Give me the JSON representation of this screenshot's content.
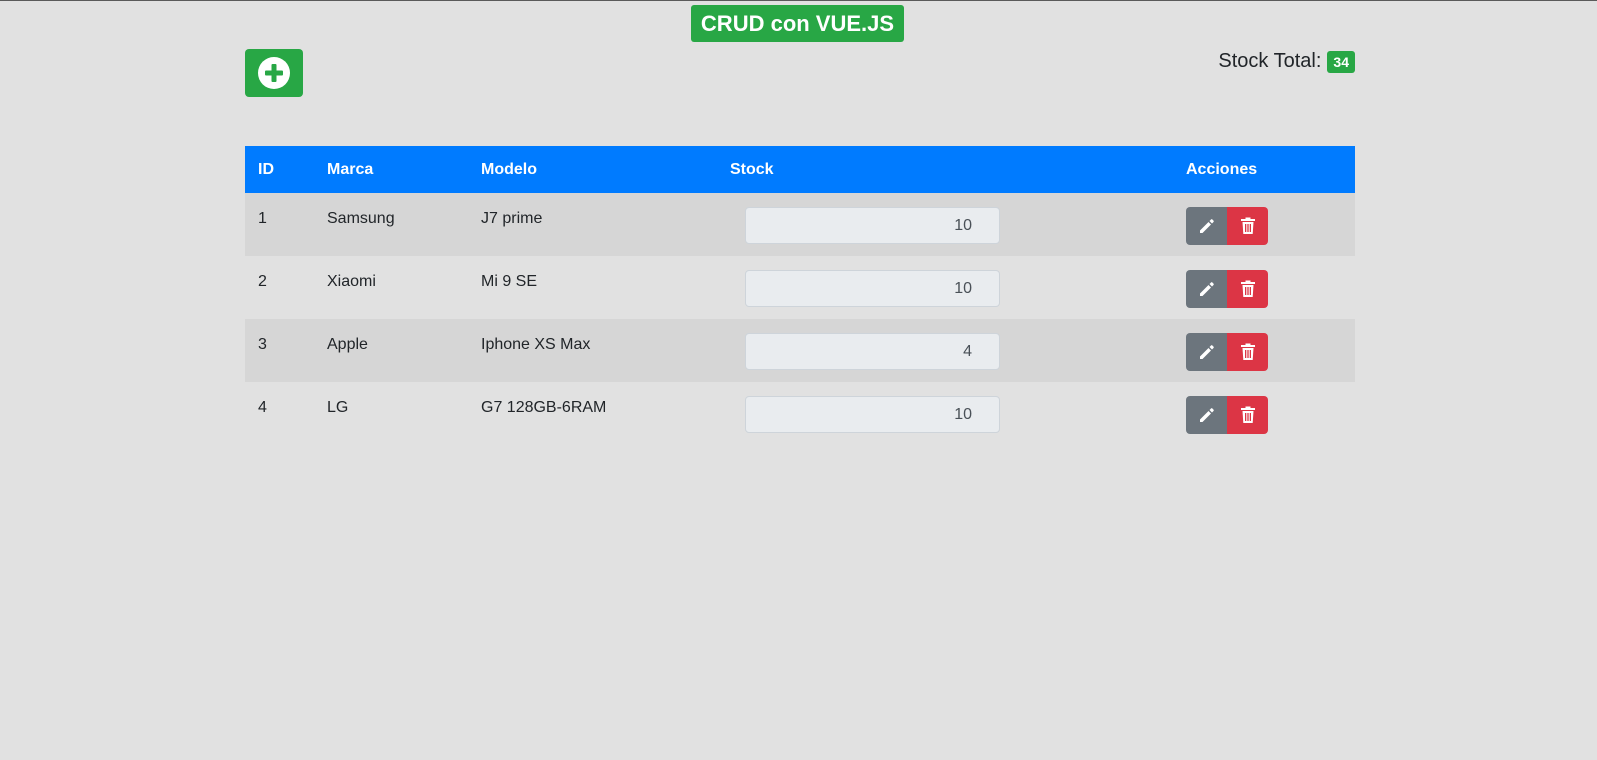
{
  "title": "CRUD con VUE.JS",
  "stock_total_label": "Stock Total:",
  "stock_total_value": "34",
  "table": {
    "headers": [
      "ID",
      "Marca",
      "Modelo",
      "Stock",
      "Acciones"
    ],
    "rows": [
      {
        "id": "1",
        "marca": "Samsung",
        "modelo": "J7 prime",
        "stock": "10"
      },
      {
        "id": "2",
        "marca": "Xiaomi",
        "modelo": "Mi 9 SE",
        "stock": "10"
      },
      {
        "id": "3",
        "marca": "Apple",
        "modelo": "Iphone XS Max",
        "stock": "4"
      },
      {
        "id": "4",
        "marca": "LG",
        "modelo": "G7 128GB-6RAM",
        "stock": "10"
      }
    ]
  },
  "icons": {
    "add": "plus-circle-icon",
    "edit": "pencil-icon",
    "delete": "trash-icon"
  },
  "colors": {
    "success": "#28a745",
    "primary": "#007bff",
    "secondary": "#6c757d",
    "danger": "#dc3545"
  }
}
